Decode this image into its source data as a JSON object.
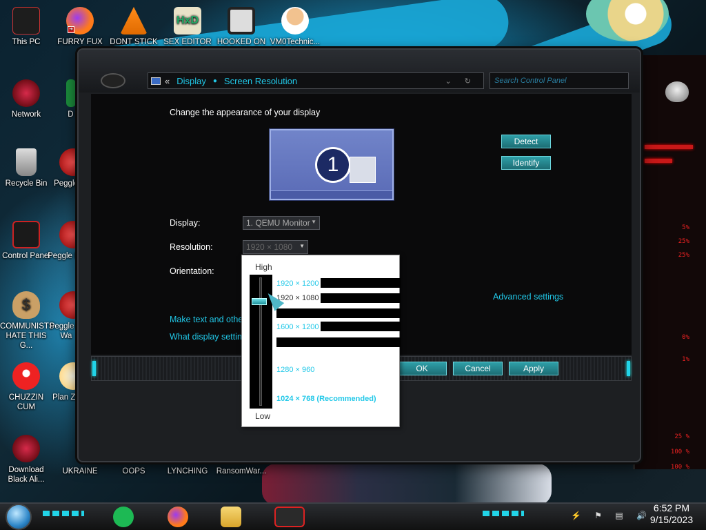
{
  "desktop": {
    "icons": [
      {
        "label": "This PC",
        "icon": "this-pc-icon"
      },
      {
        "label": "FURRY FUX",
        "icon": "firefox-icon"
      },
      {
        "label": "DONT STICK",
        "icon": "vlc-cone-icon"
      },
      {
        "label": "SEX EDITOR",
        "icon": "hxd-editor-icon"
      },
      {
        "label": "HOOKED ON",
        "icon": "game-icon"
      },
      {
        "label": "VM0Technic...",
        "icon": "doctor-icon"
      },
      {
        "label": "Network",
        "icon": "alien-network-icon"
      },
      {
        "label": "D DUM",
        "icon": "app-icon"
      },
      {
        "label": "Recycle Bin",
        "icon": "recycle-bin-icon"
      },
      {
        "label": "Peggle",
        "icon": "peggle-icon"
      },
      {
        "label": "Control Panel",
        "icon": "control-panel-icon"
      },
      {
        "label": "Peggle De",
        "icon": "peggle-icon"
      },
      {
        "label": "COMMUNISTS HATE THIS G...",
        "icon": "money-bag-icon"
      },
      {
        "label": "Peggle of Wa",
        "icon": "peggle-icon"
      },
      {
        "label": "CHUZZIN CUM",
        "icon": "chuzzle-icon"
      },
      {
        "label": "Plan Zo",
        "icon": "plants-zombies-icon"
      },
      {
        "label": "Download Black Ali...",
        "icon": "alien-download-icon"
      },
      {
        "label": "UKRAINE",
        "icon": "shortcut-icon"
      },
      {
        "label": "OOPS",
        "icon": "shortcut-icon"
      },
      {
        "label": "LYNCHING",
        "icon": "shortcut-icon"
      },
      {
        "label": "RansomWar...",
        "icon": "shortcut-icon"
      }
    ]
  },
  "right_panel": {
    "readouts": [
      "5%",
      "25%",
      "25%",
      "0%",
      "1%",
      "25 %",
      "100 %",
      "100 %"
    ]
  },
  "window": {
    "address": {
      "back": "«",
      "crumb1": "Display",
      "crumb2": "Screen Resolution"
    },
    "search_placeholder": "Search Control Panel",
    "heading": "Change the appearance of your display",
    "monitor_number": "1",
    "detect_label": "Detect",
    "identify_label": "Identify",
    "display_label": "Display:",
    "display_value": "1. QEMU Monitor",
    "resolution_label": "Resolution:",
    "resolution_value": "1920 × 1080",
    "orientation_label": "Orientation:",
    "advanced_link": "Advanced settings",
    "link_text_size": "Make text and other",
    "link_settings": "What display setting",
    "ok_label": "OK",
    "cancel_label": "Cancel",
    "apply_label": "Apply"
  },
  "resolution_dropdown": {
    "high_label": "High",
    "low_label": "Low",
    "options": [
      "1920 × 1200",
      "1920 × 1080",
      "1600 × 1200",
      "1280 × 960",
      "1024 × 768 (Recommended)"
    ],
    "selected": "1920 × 1080",
    "slider_level": 0.17
  },
  "taskbar": {
    "apps": [
      "spotify-icon",
      "firefox-icon",
      "file-explorer-icon",
      "alien-app-icon"
    ],
    "time": "6:52 PM",
    "date": "9/15/2023"
  },
  "colors": {
    "accent": "#21c8e8",
    "window_bg": "#0a0a0b",
    "alert_red": "#c81818"
  }
}
